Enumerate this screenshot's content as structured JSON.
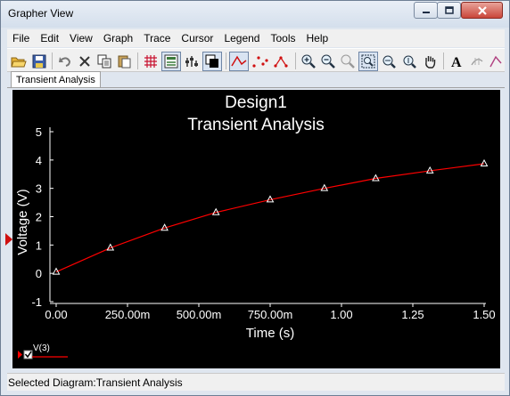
{
  "window": {
    "title": "Grapher View"
  },
  "menu": [
    "File",
    "Edit",
    "View",
    "Graph",
    "Trace",
    "Cursor",
    "Legend",
    "Tools",
    "Help"
  ],
  "toolbar": {
    "icons": [
      "open-folder-icon",
      "save-icon",
      "undo-icon",
      "delete-icon",
      "copy-icon",
      "paste-icon",
      "grid-icon",
      "legend-icon",
      "properties-icon",
      "invert-colors-icon",
      "line-trace-icon",
      "point-trace-icon",
      "line-point-trace-icon",
      "zoom-in-icon",
      "zoom-out-icon",
      "zoom-fit-icon",
      "zoom-region-icon",
      "zoom-x-icon",
      "zoom-y-icon",
      "pan-icon",
      "text-label-icon",
      "cursor-icon"
    ]
  },
  "tab": {
    "label": "Transient Analysis"
  },
  "status": {
    "text": "Selected Diagram:Transient Analysis"
  },
  "legend": {
    "trace_label": "V(3)",
    "checked": true
  },
  "colors": {
    "background": "#000000",
    "trace": "#ff0000",
    "text": "#ffffff",
    "marker": "#ffffff"
  },
  "chart_data": {
    "type": "line",
    "title": "Design1",
    "subtitle": "Transient Analysis",
    "xlabel": "Time (s)",
    "ylabel": "Voltage (V)",
    "xlim": [
      0,
      1.5
    ],
    "ylim": [
      -1,
      5
    ],
    "x_ticks": [
      0,
      0.25,
      0.5,
      0.75,
      1.0,
      1.25,
      1.5
    ],
    "x_tick_labels": [
      "0.00",
      "250.00m",
      "500.00m",
      "750.00m",
      "1.00",
      "1.25",
      "1.50"
    ],
    "y_ticks": [
      -1,
      0,
      1,
      2,
      3,
      4,
      5
    ],
    "y_tick_labels": [
      "-1",
      "0",
      "1",
      "2",
      "3",
      "4",
      "5"
    ],
    "series": [
      {
        "name": "V(3)",
        "x": [
          0.0,
          0.19,
          0.38,
          0.56,
          0.75,
          0.94,
          1.12,
          1.31,
          1.5
        ],
        "y": [
          0.05,
          0.9,
          1.6,
          2.15,
          2.6,
          3.0,
          3.35,
          3.62,
          3.87
        ]
      }
    ],
    "grid": false,
    "legend_position": "bottom-left"
  }
}
